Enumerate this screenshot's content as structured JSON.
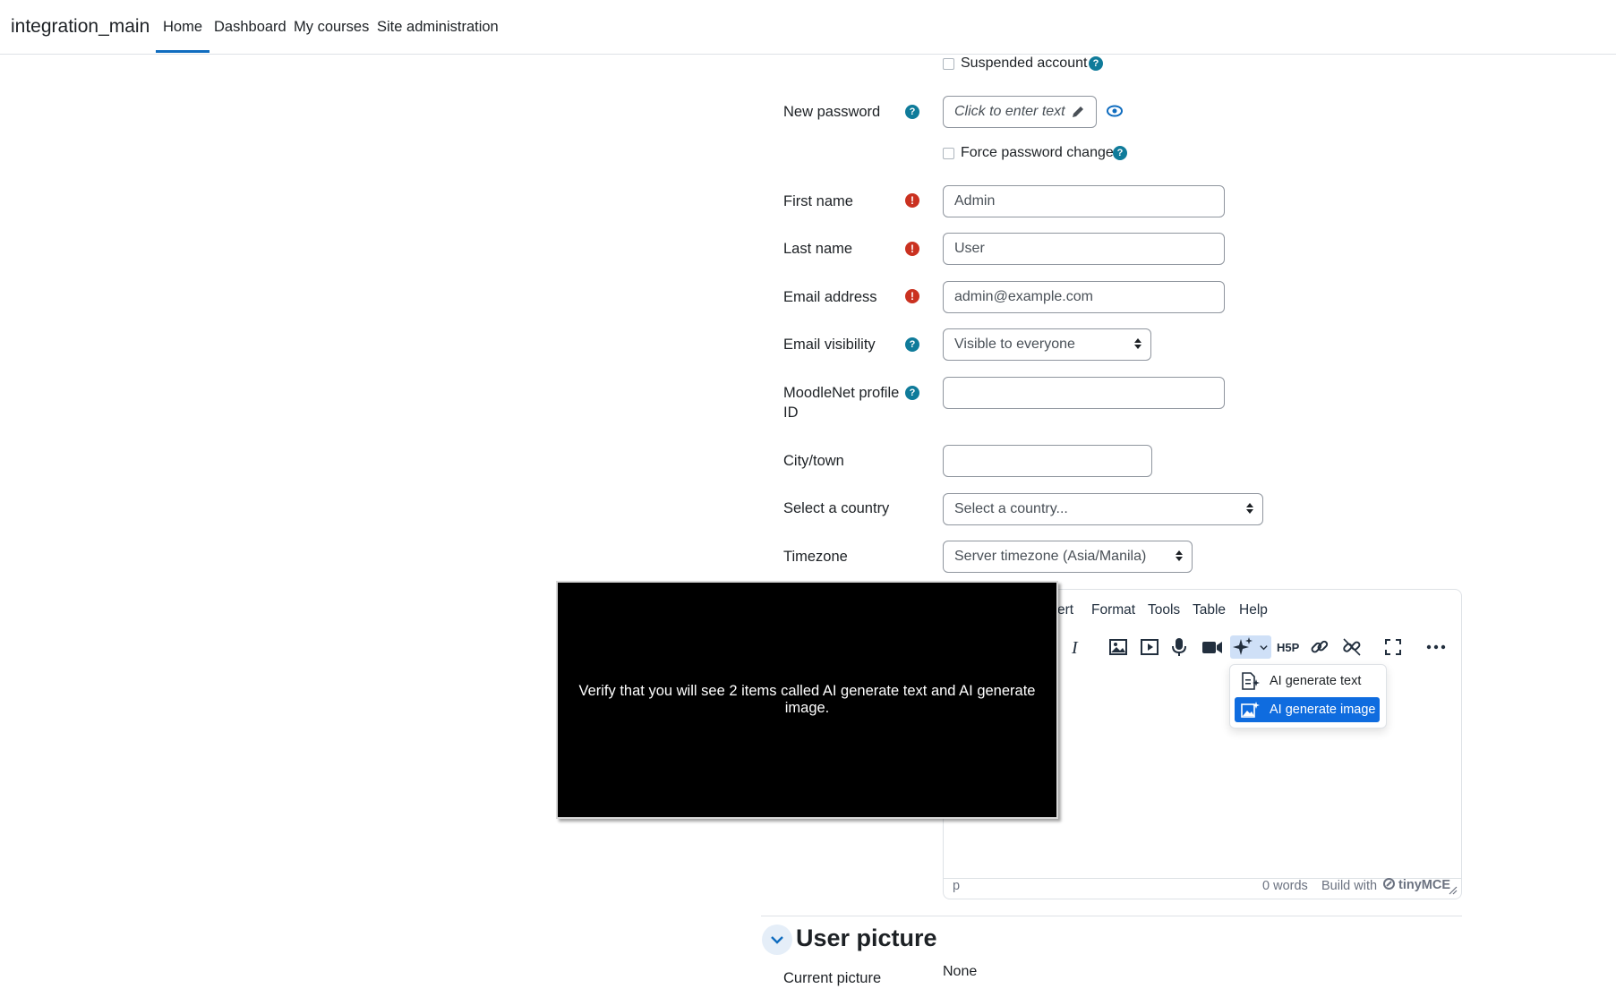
{
  "navbar": {
    "brand": "integration_main",
    "items": [
      {
        "label": "Home",
        "active": true
      },
      {
        "label": "Dashboard"
      },
      {
        "label": "My courses"
      },
      {
        "label": "Site administration"
      }
    ]
  },
  "form": {
    "suspended_label": "Suspended account",
    "new_password_label": "New password",
    "new_password_placeholder": "Click to enter text",
    "force_password_label": "Force password change",
    "first_name_label": "First name",
    "first_name_value": "Admin",
    "last_name_label": "Last name",
    "last_name_value": "User",
    "email_label": "Email address",
    "email_value": "admin@example.com",
    "email_visibility_label": "Email visibility",
    "email_visibility_value": "Visible to everyone",
    "moodlenet_label_1": "MoodleNet profile",
    "moodlenet_label_2": "ID",
    "moodlenet_value": "",
    "city_label": "City/town",
    "city_value": "",
    "country_label": "Select a country",
    "country_value": "Select a country...",
    "timezone_label": "Timezone",
    "timezone_value": "Server timezone (Asia/Manila)"
  },
  "editor": {
    "menu": [
      "ert",
      "Format",
      "Tools",
      "Table",
      "Help"
    ],
    "dropdown": {
      "item1": "AI generate text",
      "item2": "AI generate image"
    },
    "status_path": "p",
    "word_count": "0 words",
    "build_with": "Build with",
    "brand": "tinyMCE"
  },
  "section": {
    "title": "User picture",
    "current_picture_label": "Current picture",
    "current_picture_value": "None"
  },
  "overlay": {
    "text": "Verify that you will see 2 items called AI generate text and AI generate image."
  },
  "colors": {
    "accent": "#0f6cbf",
    "help": "#0f7b9a",
    "required": "#ca3120",
    "selected": "#0f6cdf"
  }
}
